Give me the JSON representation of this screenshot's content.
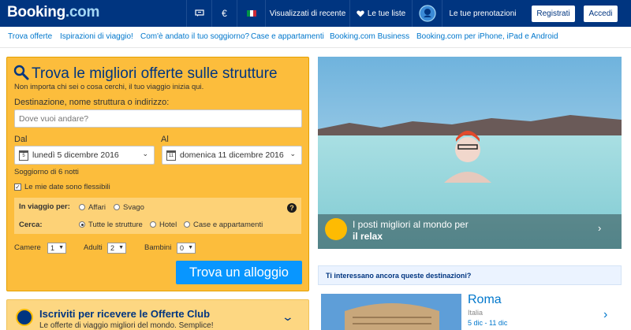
{
  "header": {
    "logo_main": "Booking",
    "logo_dotcom": ".com",
    "currency": "€",
    "recent": "Visualizzati di recente",
    "lists": "Le tue liste",
    "bookings": "Le tue prenotazioni",
    "register": "Registrati",
    "login": "Accedi"
  },
  "nav": {
    "items": [
      "Trova offerte",
      "Ispirazioni di viaggio!",
      "Com'è andato il tuo soggiorno?",
      "Case e appartamenti",
      "Booking.com Business",
      "Booking.com per iPhone, iPad e Android"
    ]
  },
  "search": {
    "title": "Trova le migliori offerte sulle strutture",
    "subtitle": "Non importa chi sei o cosa cerchi, il tuo viaggio inizia qui.",
    "destination_label": "Destinazione, nome struttura o indirizzo:",
    "destination_placeholder": "Dove vuoi andare?",
    "from_label": "Dal",
    "to_label": "Al",
    "from_day": "5",
    "to_day": "11",
    "from_value": "lunedì 5 dicembre 2016",
    "to_value": "domenica 11 dicembre 2016",
    "nights": "Soggiorno di 6 notti",
    "flexible_label": "Le mie date sono flessibili",
    "flexible_checked": true,
    "travel_label": "In viaggio per:",
    "travel_opt1": "Affari",
    "travel_opt2": "Svago",
    "search_label": "Cerca:",
    "search_opt1": "Tutte le strutture",
    "search_opt2": "Hotel",
    "search_opt3": "Case e appartamenti",
    "rooms_label": "Camere",
    "rooms_value": "1",
    "adults_label": "Adulti",
    "adults_value": "2",
    "children_label": "Bambini",
    "children_value": "0",
    "cta": "Trova un alloggio"
  },
  "club": {
    "title": "Iscriviti per ricevere le Offerte Club",
    "subtitle": "Le offerte di viaggio migliori del mondo. Semplice!"
  },
  "hero": {
    "caption_line1": "I posti migliori al mondo per",
    "caption_line2": "il relax"
  },
  "destinations": {
    "heading": "Ti interessano ancora queste destinazioni?",
    "items": [
      {
        "name": "Roma",
        "country": "Italia",
        "dates": "5 dic - 11 dic"
      }
    ]
  },
  "colors": {
    "brand_blue": "#003580",
    "accent_yellow": "#febb02",
    "link_blue": "#0077cc",
    "cta_blue": "#0896ff"
  }
}
